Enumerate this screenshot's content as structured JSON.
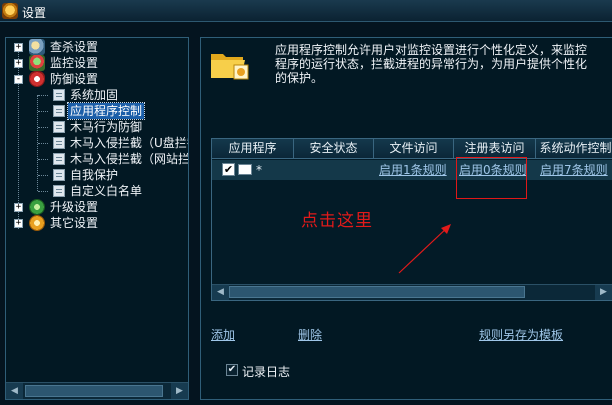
{
  "window": {
    "title": "设置"
  },
  "sidebar": {
    "items": [
      {
        "label": "查杀设置",
        "icon": "scan-settings-icon",
        "expander": "+"
      },
      {
        "label": "监控设置",
        "icon": "monitor-settings-icon",
        "expander": "+"
      },
      {
        "label": "防御设置",
        "icon": "shield-icon",
        "expander": "-"
      },
      {
        "label": "系统加固",
        "icon": "page-icon",
        "child": true
      },
      {
        "label": "应用程序控制",
        "icon": "page-icon",
        "child": true,
        "selected": true
      },
      {
        "label": "木马行为防御",
        "icon": "page-icon",
        "child": true
      },
      {
        "label": "木马入侵拦截（U盘拦截",
        "icon": "page-icon",
        "child": true
      },
      {
        "label": "木马入侵拦截（网站拦",
        "icon": "page-icon",
        "child": true
      },
      {
        "label": "自我保护",
        "icon": "page-icon",
        "child": true
      },
      {
        "label": "自定义白名单",
        "icon": "page-icon",
        "child": true
      },
      {
        "label": "升级设置",
        "icon": "upgrade-icon",
        "expander": "+"
      },
      {
        "label": "其它设置",
        "icon": "other-settings-icon",
        "expander": "+"
      }
    ]
  },
  "main": {
    "description": "应用程序控制允许用户对监控设置进行个性化定义，来监控程序的运行状态，拦截进程的异常行为，为用户提供个性化的保护。",
    "table": {
      "columns": [
        "应用程序",
        "安全状态",
        "文件访问",
        "注册表访问",
        "系统动作控制"
      ],
      "rows": [
        {
          "checked": true,
          "app": "*",
          "security_status": "",
          "file_access": "启用1条规则",
          "registry_access": "启用0条规则",
          "system_action": "启用7条规则"
        }
      ]
    },
    "annotation": "点击这里",
    "annotation_color": "#e21a1a",
    "links": {
      "add": "添加",
      "delete": "删除",
      "save_template": "规则另存为模板"
    },
    "log": {
      "label": "记录日志",
      "checked": true
    }
  },
  "colors": {
    "background": "#04141f",
    "selected": "#1b5ea8",
    "link": "#9fc6e8",
    "row_highlight": "#143849"
  }
}
